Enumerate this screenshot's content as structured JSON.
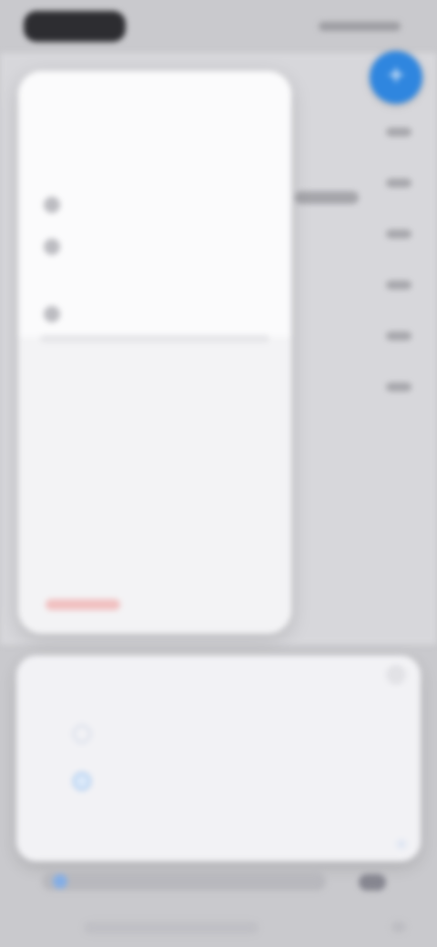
{
  "status_bar": {
    "time_pill": "",
    "right_indicators": ""
  },
  "menu": {
    "header_title": "",
    "items": [
      {
        "label": ""
      },
      {
        "label": ""
      },
      {
        "label": ""
      }
    ],
    "rows": [
      {
        "label": ""
      },
      {
        "label": ""
      },
      {
        "label": ""
      },
      {
        "label": ""
      }
    ],
    "danger_label": ""
  },
  "sheet": {
    "title": "",
    "options": [
      {
        "label": ""
      },
      {
        "label": ""
      }
    ]
  },
  "colors": {
    "accent": "#2F86DF",
    "background": "#C9C9CD",
    "card": "#F3F3F5"
  },
  "icons": {
    "fab_icon": "add-icon"
  }
}
